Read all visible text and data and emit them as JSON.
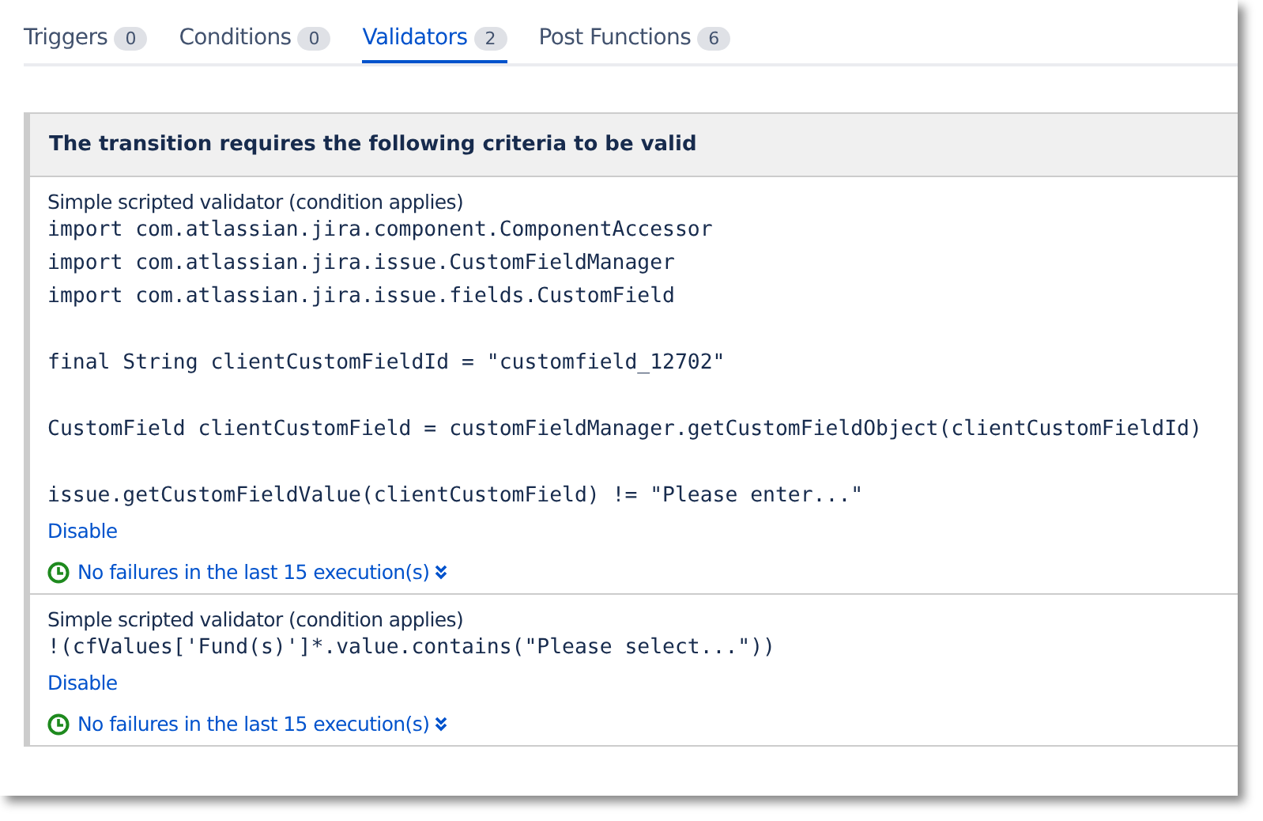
{
  "tabs": [
    {
      "label": "Triggers",
      "count": "0",
      "selected": false
    },
    {
      "label": "Conditions",
      "count": "0",
      "selected": false
    },
    {
      "label": "Validators",
      "count": "2",
      "selected": true
    },
    {
      "label": "Post Functions",
      "count": "6",
      "selected": false
    }
  ],
  "panel": {
    "title": "The transition requires the following criteria to be valid",
    "validators": [
      {
        "name": "Simple scripted validator (condition applies)",
        "code": "import com.atlassian.jira.component.ComponentAccessor\nimport com.atlassian.jira.issue.CustomFieldManager\nimport com.atlassian.jira.issue.fields.CustomField\n\nfinal String clientCustomFieldId = \"customfield_12702\"\n\nCustomField clientCustomField = customFieldManager.getCustomFieldObject(clientCustomFieldId)\n\nissue.getCustomFieldValue(clientCustomField) != \"Please enter...\"",
        "action": "Disable",
        "status": "No failures in the last 15 execution(s)"
      },
      {
        "name": "Simple scripted validator (condition applies)",
        "code": "!(cfValues['Fund(s)']*.value.contains(\"Please select...\"))",
        "action": "Disable",
        "status": "No failures in the last 15 execution(s)"
      }
    ]
  }
}
